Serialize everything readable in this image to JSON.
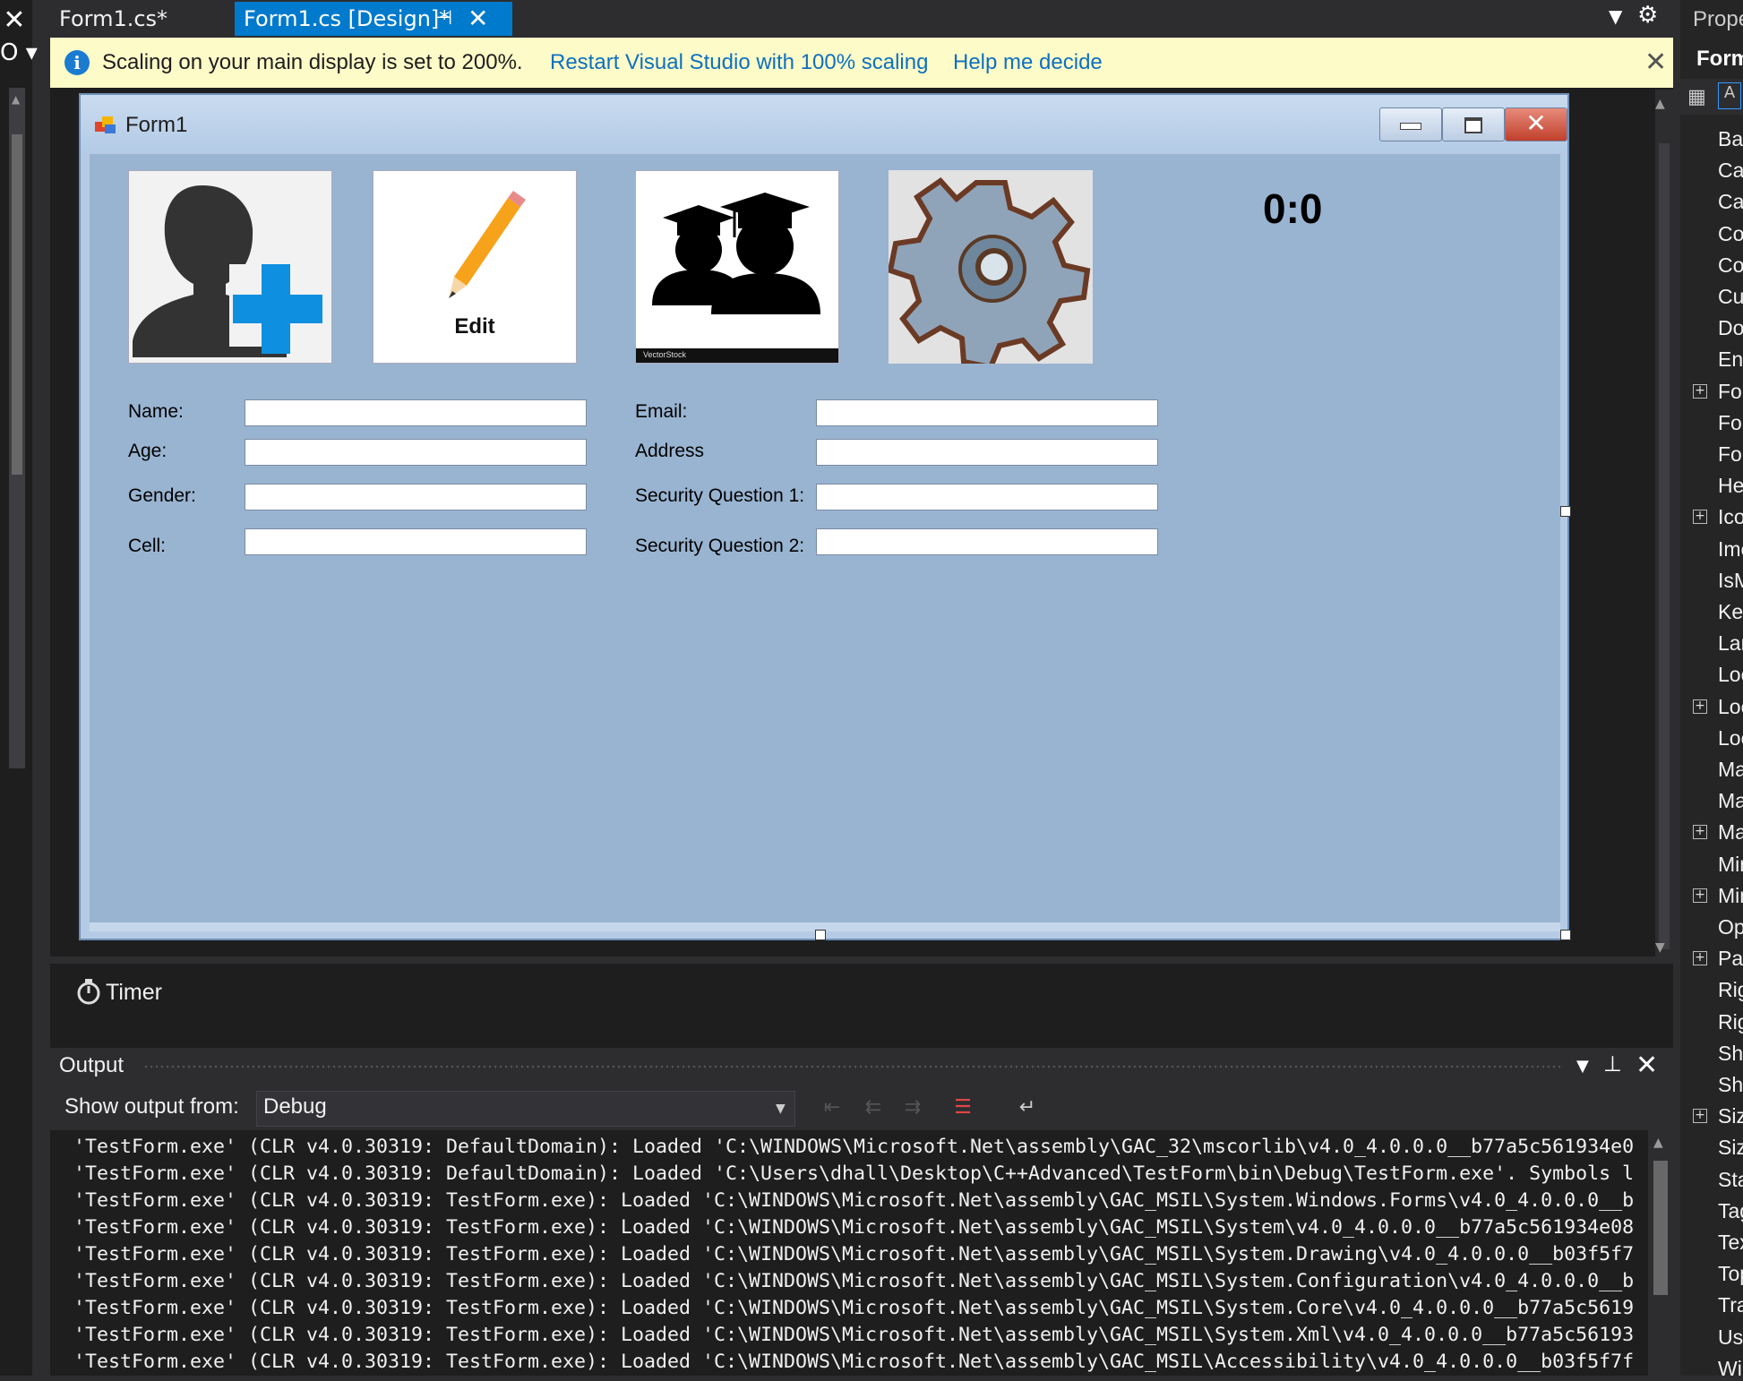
{
  "tabs": {
    "code": "Form1.cs*",
    "design": "Form1.cs [Design]*",
    "pin": "⊣",
    "close": "✕"
  },
  "infobar": {
    "message": "Scaling on your main display is set to 200%.",
    "restart_link": "Restart Visual Studio with 100% scaling",
    "help_link": "Help me decide",
    "icon": "info-icon"
  },
  "form": {
    "title": "Form1",
    "score": "0:0",
    "edit_caption": "Edit",
    "labels": {
      "name": "Name:",
      "age": "Age:",
      "gender": "Gender:",
      "cell": "Cell:",
      "email": "Email:",
      "address": "Address",
      "security1": "Security Question 1:",
      "security2": "Security Question 2:"
    },
    "vectorstock_caption": "VectorStock"
  },
  "tray": {
    "timer": "Timer"
  },
  "output": {
    "title": "Output",
    "show_from_label": "Show output from:",
    "source": "Debug",
    "lines": [
      "'TestForm.exe' (CLR v4.0.30319: DefaultDomain): Loaded 'C:\\WINDOWS\\Microsoft.Net\\assembly\\GAC_32\\mscorlib\\v4.0_4.0.0.0__b77a5c561934e0",
      "'TestForm.exe' (CLR v4.0.30319: DefaultDomain): Loaded 'C:\\Users\\dhall\\Desktop\\C++Advanced\\TestForm\\bin\\Debug\\TestForm.exe'. Symbols l",
      "'TestForm.exe' (CLR v4.0.30319: TestForm.exe): Loaded 'C:\\WINDOWS\\Microsoft.Net\\assembly\\GAC_MSIL\\System.Windows.Forms\\v4.0_4.0.0.0__b",
      "'TestForm.exe' (CLR v4.0.30319: TestForm.exe): Loaded 'C:\\WINDOWS\\Microsoft.Net\\assembly\\GAC_MSIL\\System\\v4.0_4.0.0.0__b77a5c561934e08",
      "'TestForm.exe' (CLR v4.0.30319: TestForm.exe): Loaded 'C:\\WINDOWS\\Microsoft.Net\\assembly\\GAC_MSIL\\System.Drawing\\v4.0_4.0.0.0__b03f5f7",
      "'TestForm.exe' (CLR v4.0.30319: TestForm.exe): Loaded 'C:\\WINDOWS\\Microsoft.Net\\assembly\\GAC_MSIL\\System.Configuration\\v4.0_4.0.0.0__b",
      "'TestForm.exe' (CLR v4.0.30319: TestForm.exe): Loaded 'C:\\WINDOWS\\Microsoft.Net\\assembly\\GAC_MSIL\\System.Core\\v4.0_4.0.0.0__b77a5c5619",
      "'TestForm.exe' (CLR v4.0.30319: TestForm.exe): Loaded 'C:\\WINDOWS\\Microsoft.Net\\assembly\\GAC_MSIL\\System.Xml\\v4.0_4.0.0.0__b77a5c56193",
      "'TestForm.exe' (CLR v4.0.30319: TestForm.exe): Loaded 'C:\\WINDOWS\\Microsoft.Net\\assembly\\GAC_MSIL\\Accessibility\\v4.0_4.0.0.0__b03f5f7f"
    ]
  },
  "properties": {
    "title": "Proper",
    "object": "Form",
    "items": [
      {
        "name": "Back",
        "expandable": false
      },
      {
        "name": "Canc",
        "expandable": false
      },
      {
        "name": "Caus",
        "expandable": false
      },
      {
        "name": "Con",
        "expandable": false
      },
      {
        "name": "Con",
        "expandable": false
      },
      {
        "name": "Curs",
        "expandable": false
      },
      {
        "name": "Dou",
        "expandable": false
      },
      {
        "name": "Enab",
        "expandable": false
      },
      {
        "name": "Font",
        "expandable": true
      },
      {
        "name": "Fore",
        "expandable": false
      },
      {
        "name": "Form",
        "expandable": false
      },
      {
        "name": "Help",
        "expandable": false
      },
      {
        "name": "Icon",
        "expandable": true
      },
      {
        "name": "Imel",
        "expandable": false
      },
      {
        "name": "IsMd",
        "expandable": false
      },
      {
        "name": "KeyI",
        "expandable": false
      },
      {
        "name": "Lang",
        "expandable": false
      },
      {
        "name": "Loca",
        "expandable": false
      },
      {
        "name": "Loca",
        "expandable": true
      },
      {
        "name": "Lock",
        "expandable": false
      },
      {
        "name": "Main",
        "expandable": false
      },
      {
        "name": "Max",
        "expandable": false
      },
      {
        "name": "Max",
        "expandable": true
      },
      {
        "name": "Mini",
        "expandable": false
      },
      {
        "name": "Mini",
        "expandable": true
      },
      {
        "name": "Opa",
        "expandable": false
      },
      {
        "name": "Padd",
        "expandable": true
      },
      {
        "name": "Righ",
        "expandable": false
      },
      {
        "name": "Righ",
        "expandable": false
      },
      {
        "name": "Shov",
        "expandable": false
      },
      {
        "name": "Shov",
        "expandable": false
      },
      {
        "name": "Size",
        "expandable": true
      },
      {
        "name": "Size",
        "expandable": false
      },
      {
        "name": "Start",
        "expandable": false
      },
      {
        "name": "Tag",
        "expandable": false
      },
      {
        "name": "Text",
        "expandable": false
      },
      {
        "name": "TopI",
        "expandable": false
      },
      {
        "name": "Tran",
        "expandable": false
      },
      {
        "name": "UseV",
        "expandable": false
      },
      {
        "name": "Win",
        "expandable": false
      }
    ]
  },
  "colors": {
    "accent": "#007acc",
    "infobar_bg": "#fdfbc8",
    "link": "#0e70c0",
    "form_client": "#99b4d1"
  }
}
